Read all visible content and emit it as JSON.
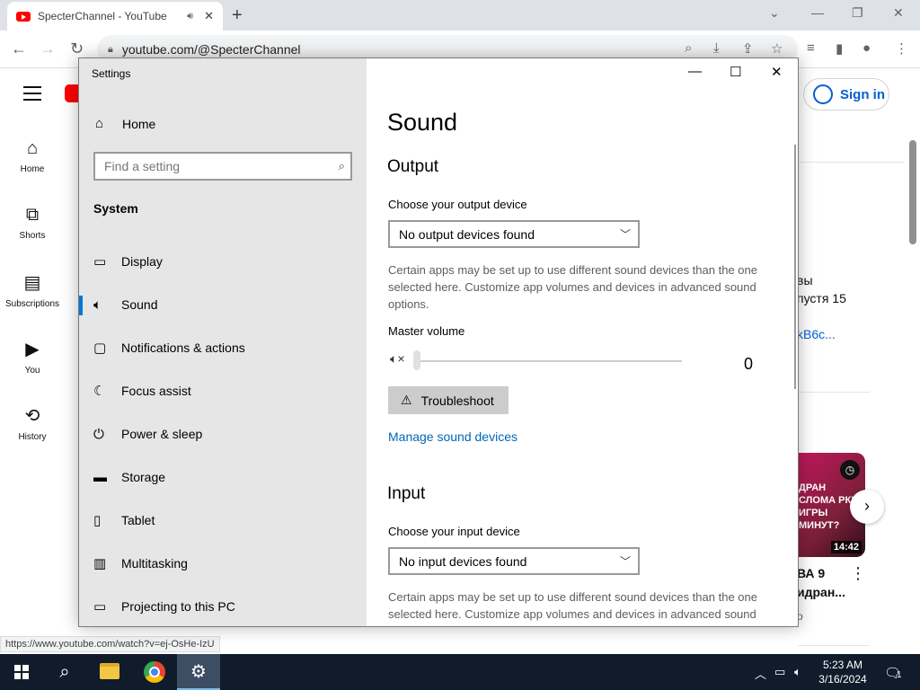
{
  "browser": {
    "tab_title": "SpecterChannel - YouTube",
    "url": "youtube.com/@SpecterChannel",
    "status_url": "https://www.youtube.com/watch?v=ej-OsHe-IzU"
  },
  "youtube": {
    "sign_in": "Sign in",
    "sidebar": [
      {
        "label": "Home",
        "icon": "home-icon"
      },
      {
        "label": "Shorts",
        "icon": "shorts-icon"
      },
      {
        "label": "Subscriptions",
        "icon": "subscriptions-icon"
      },
      {
        "label": "You",
        "icon": "you-icon"
      },
      {
        "label": "History",
        "icon": "history-icon"
      }
    ],
    "right_fragments": {
      "line1": "вы",
      "line2": "пустя 15",
      "link": "kB6c...",
      "video_title1": "ВА 9",
      "video_title2": "идран...",
      "thumb_text": "ДРАН СЛОМА РКУР ИГРЫ МИНУТ?",
      "thumb_duration": "14:42",
      "bottom_fragment": "о"
    }
  },
  "settings": {
    "window_title": "Settings",
    "home": "Home",
    "search_placeholder": "Find a setting",
    "section": "System",
    "nav": [
      {
        "label": "Display",
        "icon": "display-icon"
      },
      {
        "label": "Sound",
        "icon": "sound-icon",
        "active": true
      },
      {
        "label": "Notifications & actions",
        "icon": "notifications-icon"
      },
      {
        "label": "Focus assist",
        "icon": "focus-assist-icon"
      },
      {
        "label": "Power & sleep",
        "icon": "power-icon"
      },
      {
        "label": "Storage",
        "icon": "storage-icon"
      },
      {
        "label": "Tablet",
        "icon": "tablet-icon"
      },
      {
        "label": "Multitasking",
        "icon": "multitasking-icon"
      },
      {
        "label": "Projecting to this PC",
        "icon": "projecting-icon"
      }
    ],
    "page_title": "Sound",
    "output": {
      "heading": "Output",
      "device_label": "Choose your output device",
      "device_value": "No output devices found",
      "note": "Certain apps may be set up to use different sound devices than the one selected here. Customize app volumes and devices in advanced sound options.",
      "master_volume_label": "Master volume",
      "master_volume_value": "0",
      "troubleshoot": "Troubleshoot",
      "manage_link": "Manage sound devices"
    },
    "input": {
      "heading": "Input",
      "device_label": "Choose your input device",
      "device_value": "No input devices found",
      "note": "Certain apps may be set up to use different sound devices than the one selected here. Customize app volumes and devices in advanced sound options."
    }
  },
  "taskbar": {
    "time": "5:23 AM",
    "date": "3/16/2024",
    "notification_count": "1"
  },
  "colors": {
    "accent": "#0078d7",
    "link": "#0067b8",
    "taskbar": "#101c2c",
    "youtube_red": "#ff0000"
  }
}
